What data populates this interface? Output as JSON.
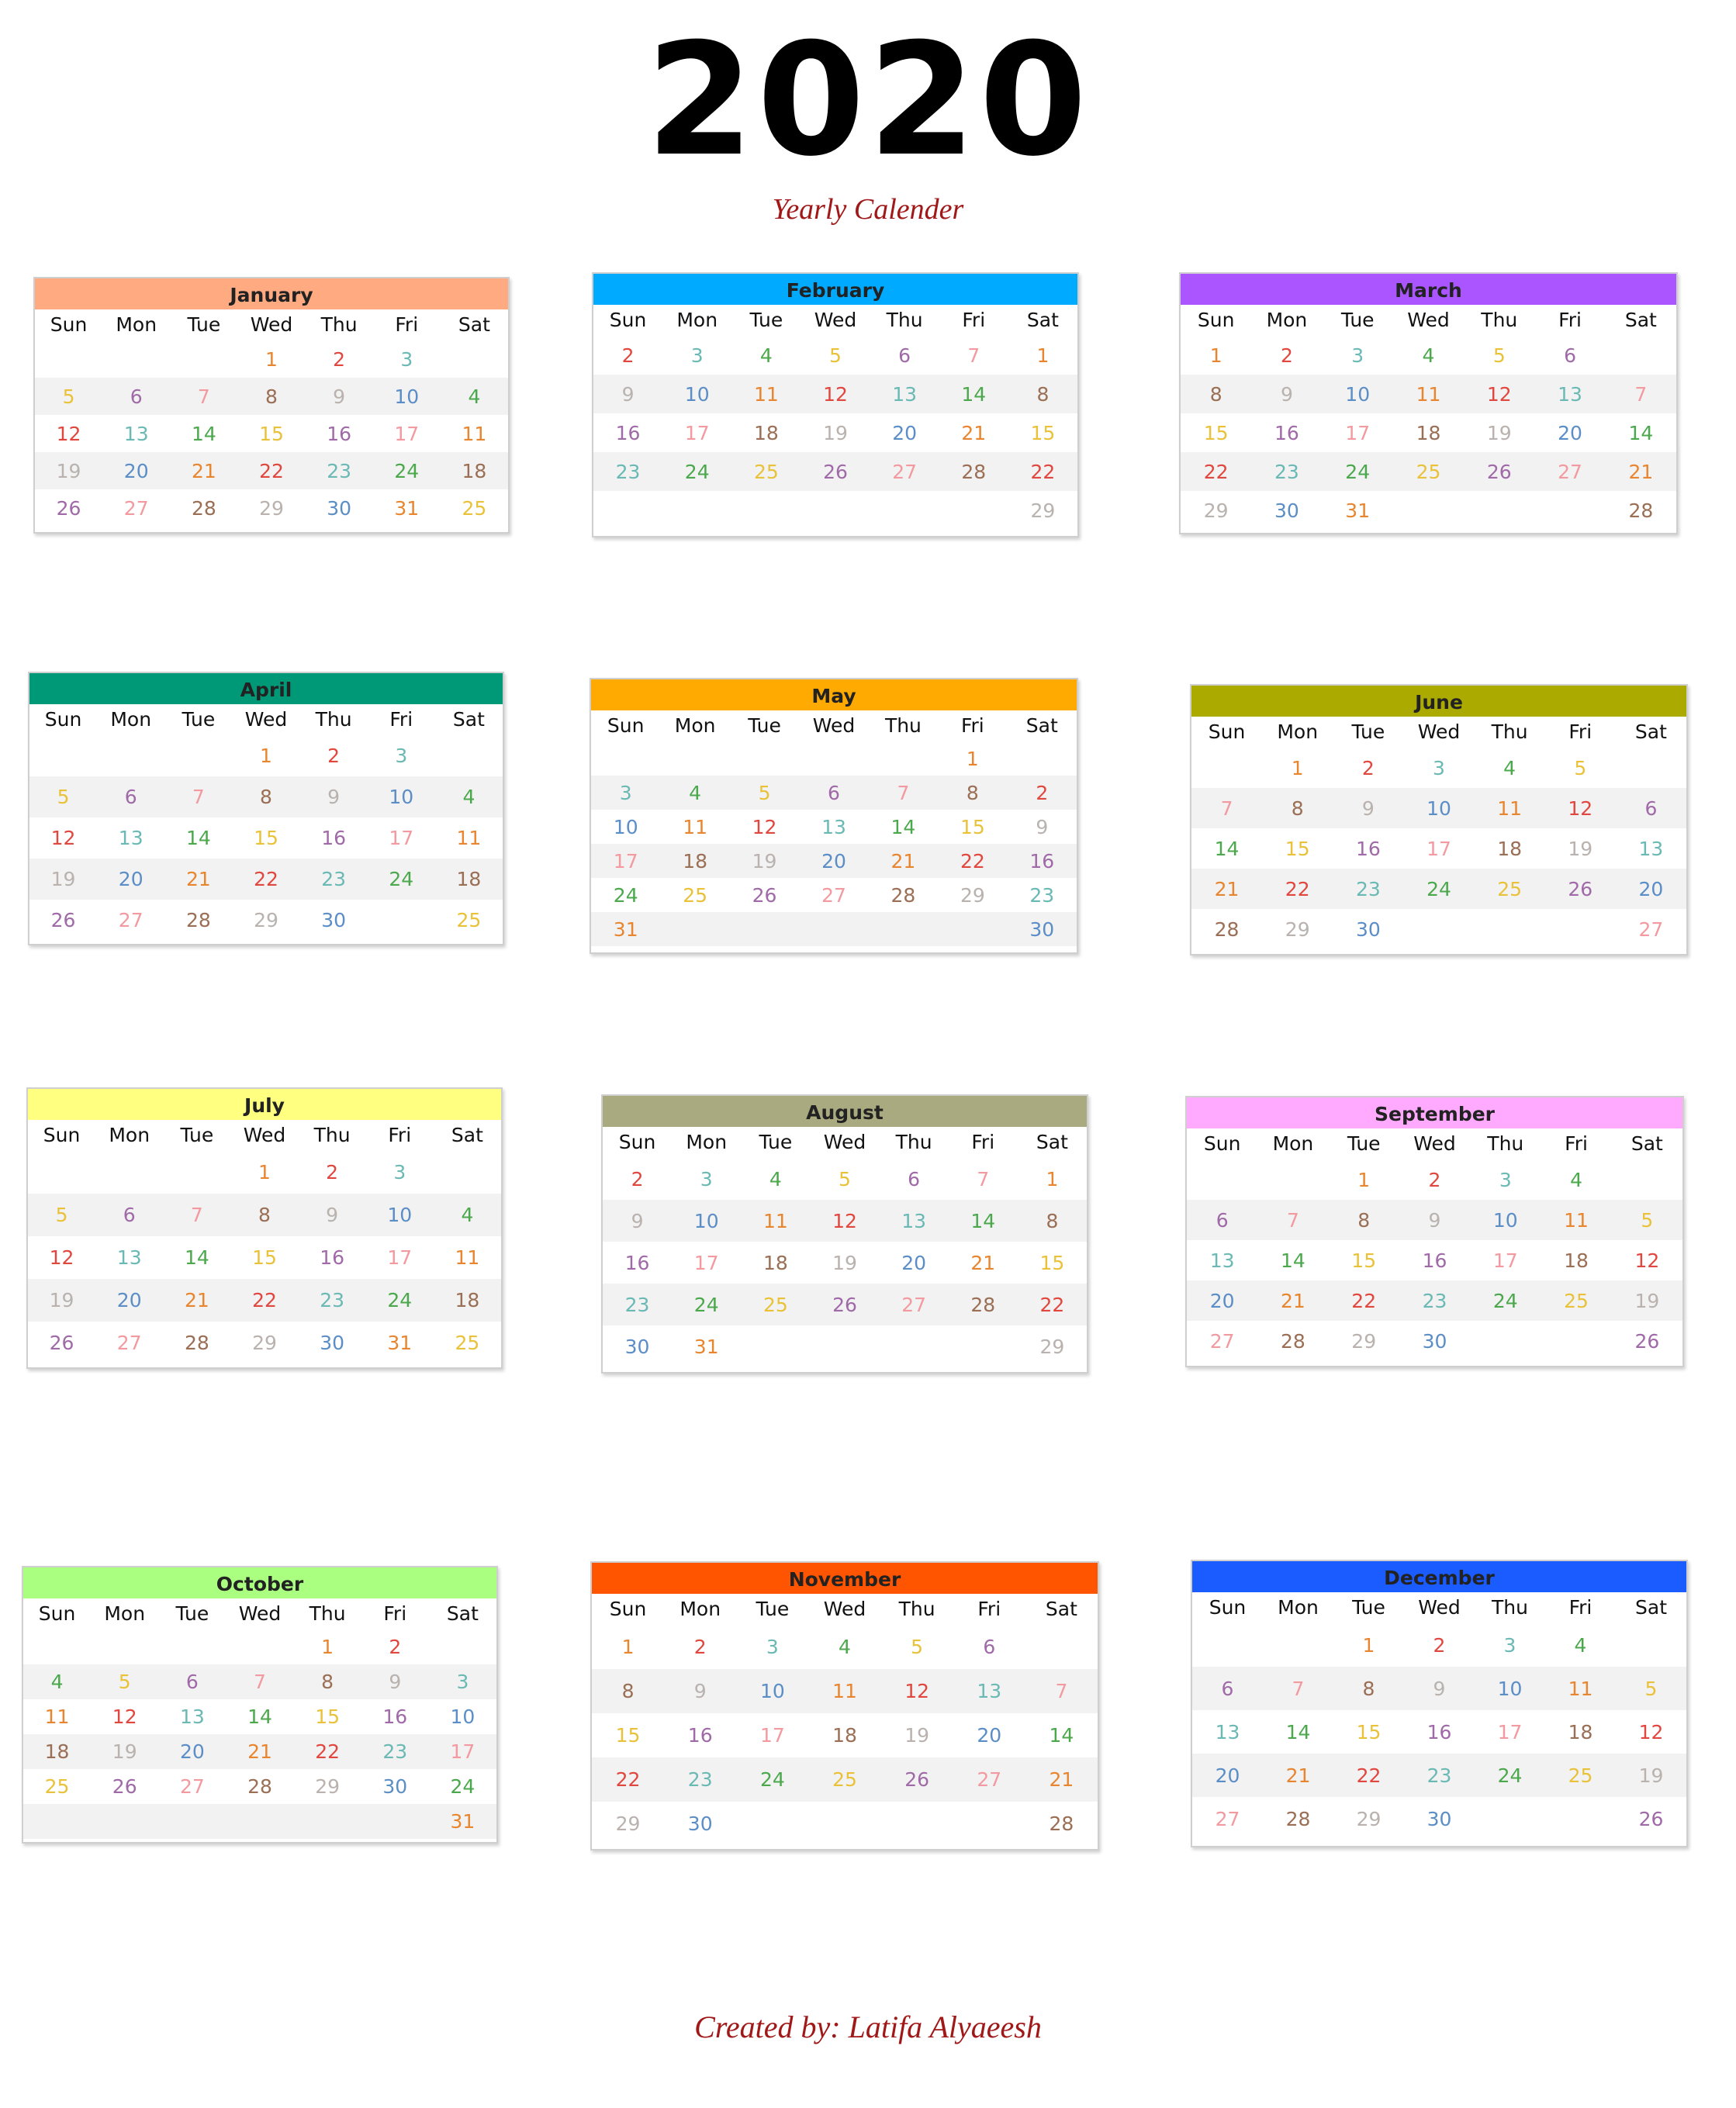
{
  "title": "2020",
  "subtitle": "Yearly Calender",
  "footer": "Created by: Latifa Alyaeesh",
  "weekdays": [
    "Sun",
    "Mon",
    "Tue",
    "Wed",
    "Thu",
    "Fri",
    "Sat"
  ],
  "palette": [
    "#5b8ec6",
    "#e8852f",
    "#e0473f",
    "#6ab9b4",
    "#4ca84c",
    "#e9c23a",
    "#a06aa8",
    "#f29aa0",
    "#9b6f55",
    "#b9b2ae"
  ],
  "months": [
    {
      "name": "January",
      "color": "#ffaa80",
      "rows": [
        [
          "",
          "",
          "",
          "1",
          "2",
          "3",
          ""
        ],
        [
          "5",
          "6",
          "7",
          "8",
          "9",
          "10",
          "4"
        ],
        [
          "12",
          "13",
          "14",
          "15",
          "16",
          "17",
          "11"
        ],
        [
          "19",
          "20",
          "21",
          "22",
          "23",
          "24",
          "18"
        ],
        [
          "26",
          "27",
          "28",
          "29",
          "30",
          "31",
          "25"
        ]
      ]
    },
    {
      "name": "February",
      "color": "#00aaff",
      "rows": [
        [
          "2",
          "3",
          "4",
          "5",
          "6",
          "7",
          "1"
        ],
        [
          "9",
          "10",
          "11",
          "12",
          "13",
          "14",
          "8"
        ],
        [
          "16",
          "17",
          "18",
          "19",
          "20",
          "21",
          "15"
        ],
        [
          "23",
          "24",
          "25",
          "26",
          "27",
          "28",
          "22"
        ],
        [
          "",
          "",
          "",
          "",
          "",
          "",
          "29"
        ]
      ]
    },
    {
      "name": "March",
      "color": "#aa55ff",
      "rows": [
        [
          "1",
          "2",
          "3",
          "4",
          "5",
          "6",
          ""
        ],
        [
          "8",
          "9",
          "10",
          "11",
          "12",
          "13",
          "7"
        ],
        [
          "15",
          "16",
          "17",
          "18",
          "19",
          "20",
          "14"
        ],
        [
          "22",
          "23",
          "24",
          "25",
          "26",
          "27",
          "21"
        ],
        [
          "29",
          "30",
          "31",
          "",
          "",
          "",
          "28"
        ]
      ]
    },
    {
      "name": "April",
      "color": "#009977",
      "rows": [
        [
          "",
          "",
          "",
          "1",
          "2",
          "3",
          ""
        ],
        [
          "5",
          "6",
          "7",
          "8",
          "9",
          "10",
          "4"
        ],
        [
          "12",
          "13",
          "14",
          "15",
          "16",
          "17",
          "11"
        ],
        [
          "19",
          "20",
          "21",
          "22",
          "23",
          "24",
          "18"
        ],
        [
          "26",
          "27",
          "28",
          "29",
          "30",
          "",
          "25"
        ]
      ]
    },
    {
      "name": "May",
      "color": "#ffaa00",
      "rows": [
        [
          "",
          "",
          "",
          "",
          "",
          "1",
          ""
        ],
        [
          "3",
          "4",
          "5",
          "6",
          "7",
          "8",
          "2"
        ],
        [
          "10",
          "11",
          "12",
          "13",
          "14",
          "15",
          "9"
        ],
        [
          "17",
          "18",
          "19",
          "20",
          "21",
          "22",
          "16"
        ],
        [
          "24",
          "25",
          "26",
          "27",
          "28",
          "29",
          "23"
        ],
        [
          "31",
          "",
          "",
          "",
          "",
          "",
          "30"
        ]
      ]
    },
    {
      "name": "June",
      "color": "#aaaa00",
      "rows": [
        [
          "",
          "1",
          "2",
          "3",
          "4",
          "5",
          ""
        ],
        [
          "7",
          "8",
          "9",
          "10",
          "11",
          "12",
          "6"
        ],
        [
          "14",
          "15",
          "16",
          "17",
          "18",
          "19",
          "13"
        ],
        [
          "21",
          "22",
          "23",
          "24",
          "25",
          "26",
          "20"
        ],
        [
          "28",
          "29",
          "30",
          "",
          "",
          "",
          "27"
        ]
      ]
    },
    {
      "name": "July",
      "color": "#ffff80",
      "rows": [
        [
          "",
          "",
          "",
          "1",
          "2",
          "3",
          ""
        ],
        [
          "5",
          "6",
          "7",
          "8",
          "9",
          "10",
          "4"
        ],
        [
          "12",
          "13",
          "14",
          "15",
          "16",
          "17",
          "11"
        ],
        [
          "19",
          "20",
          "21",
          "22",
          "23",
          "24",
          "18"
        ],
        [
          "26",
          "27",
          "28",
          "29",
          "30",
          "31",
          "25"
        ]
      ]
    },
    {
      "name": "August",
      "color": "#aaaa80",
      "rows": [
        [
          "2",
          "3",
          "4",
          "5",
          "6",
          "7",
          "1"
        ],
        [
          "9",
          "10",
          "11",
          "12",
          "13",
          "14",
          "8"
        ],
        [
          "16",
          "17",
          "18",
          "19",
          "20",
          "21",
          "15"
        ],
        [
          "23",
          "24",
          "25",
          "26",
          "27",
          "28",
          "22"
        ],
        [
          "30",
          "31",
          "",
          "",
          "",
          "",
          "29"
        ]
      ]
    },
    {
      "name": "September",
      "color": "#ffaaff",
      "rows": [
        [
          "",
          "",
          "1",
          "2",
          "3",
          "4",
          ""
        ],
        [
          "6",
          "7",
          "8",
          "9",
          "10",
          "11",
          "5"
        ],
        [
          "13",
          "14",
          "15",
          "16",
          "17",
          "18",
          "12"
        ],
        [
          "20",
          "21",
          "22",
          "23",
          "24",
          "25",
          "19"
        ],
        [
          "27",
          "28",
          "29",
          "30",
          "",
          "",
          "26"
        ]
      ]
    },
    {
      "name": "October",
      "color": "#aaff80",
      "rows": [
        [
          "",
          "",
          "",
          "",
          "1",
          "2",
          ""
        ],
        [
          "4",
          "5",
          "6",
          "7",
          "8",
          "9",
          "3"
        ],
        [
          "11",
          "12",
          "13",
          "14",
          "15",
          "16",
          "10"
        ],
        [
          "18",
          "19",
          "20",
          "21",
          "22",
          "23",
          "17"
        ],
        [
          "25",
          "26",
          "27",
          "28",
          "29",
          "30",
          "24"
        ],
        [
          "",
          "",
          "",
          "",
          "",
          "",
          "31"
        ]
      ]
    },
    {
      "name": "November",
      "color": "#ff5500",
      "rows": [
        [
          "1",
          "2",
          "3",
          "4",
          "5",
          "6",
          ""
        ],
        [
          "8",
          "9",
          "10",
          "11",
          "12",
          "13",
          "7"
        ],
        [
          "15",
          "16",
          "17",
          "18",
          "19",
          "20",
          "14"
        ],
        [
          "22",
          "23",
          "24",
          "25",
          "26",
          "27",
          "21"
        ],
        [
          "29",
          "30",
          "",
          "",
          "",
          "",
          "28"
        ]
      ]
    },
    {
      "name": "December",
      "color": "#1a5cff",
      "rows": [
        [
          "",
          "",
          "1",
          "2",
          "3",
          "4",
          ""
        ],
        [
          "6",
          "7",
          "8",
          "9",
          "10",
          "11",
          "5"
        ],
        [
          "13",
          "14",
          "15",
          "16",
          "17",
          "18",
          "12"
        ],
        [
          "20",
          "21",
          "22",
          "23",
          "24",
          "25",
          "19"
        ],
        [
          "27",
          "28",
          "29",
          "30",
          "",
          "",
          "26"
        ]
      ]
    }
  ]
}
